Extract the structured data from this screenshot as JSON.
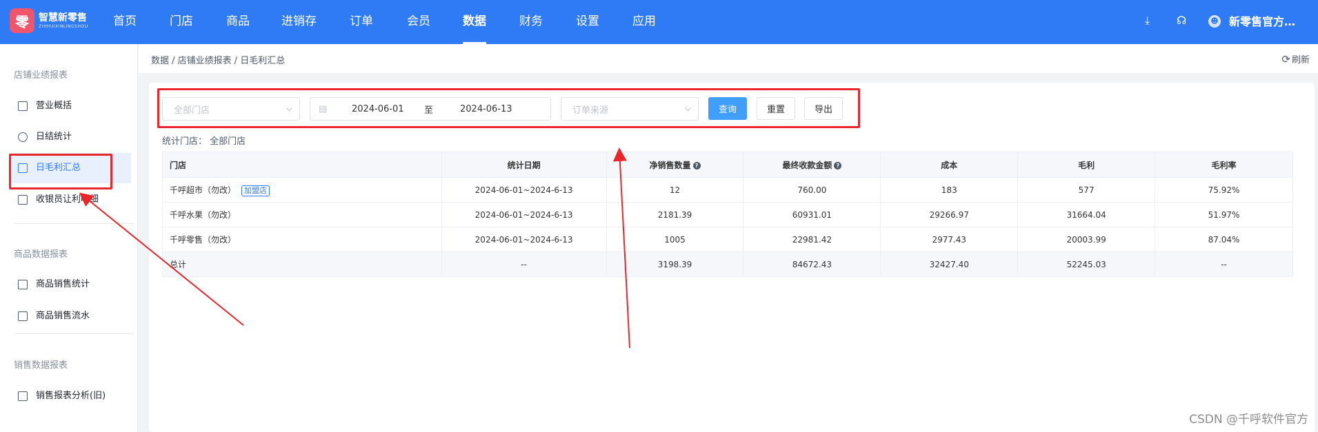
{
  "brand": {
    "logo_glyph": "零",
    "name_cn": "智慧新零售",
    "name_en": "ZHIHUIXINLINGSHOU"
  },
  "nav": {
    "items": [
      "首页",
      "门店",
      "商品",
      "进销存",
      "订单",
      "会员",
      "数据",
      "财务",
      "设置",
      "应用"
    ],
    "active": "数据"
  },
  "header": {
    "download_icon": "⤓",
    "headset_icon": "☊",
    "user_avatar": "☻",
    "user_name": "新零售官方…"
  },
  "sidebar": {
    "group1": "店铺业绩报表",
    "items1": [
      "营业概括",
      "日结统计",
      "日毛利汇总",
      "收银员让利明细"
    ],
    "group2": "商品数据报表",
    "items2": [
      "商品销售统计",
      "商品销售流水"
    ],
    "group3": "销售数据报表",
    "items3": [
      "销售报表分析(旧)"
    ]
  },
  "breadcrumb": "数据 / 店铺业绩报表 / 日毛利汇总",
  "refresh_label": "刷新",
  "filters": {
    "store_placeholder": "全部门店",
    "date_start": "2024-06-01",
    "date_sep": "至",
    "date_end": "2024-06-13",
    "order_source_placeholder": "订单来源",
    "query_label": "查询",
    "reset_label": "重置",
    "export_label": "导出"
  },
  "stat_store": "统计门店： 全部门店",
  "table": {
    "columns": [
      "门店",
      "统计日期",
      "净销售数量",
      "最终收款金额",
      "成本",
      "毛利",
      "毛利率"
    ],
    "rows": [
      {
        "store": "千呼超市（勿改）",
        "tag": "加盟店",
        "date": "2024-06-01~2024-6-13",
        "qty": "12",
        "amount": "760.00",
        "cost": "183",
        "profit": "577",
        "rate": "75.92%"
      },
      {
        "store": "千呼水果（勿改）",
        "tag": "",
        "date": "2024-06-01~2024-6-13",
        "qty": "2181.39",
        "amount": "60931.01",
        "cost": "29266.97",
        "profit": "31664.04",
        "rate": "51.97%"
      },
      {
        "store": "千呼零售（勿改）",
        "tag": "",
        "date": "2024-06-01~2024-6-13",
        "qty": "1005",
        "amount": "22981.42",
        "cost": "2977.43",
        "profit": "20003.99",
        "rate": "87.04%"
      }
    ],
    "total": {
      "store": "总计",
      "date": "--",
      "qty": "3198.39",
      "amount": "84672.43",
      "cost": "32427.40",
      "profit": "52245.03",
      "rate": "--"
    }
  },
  "watermark": "CSDN @千呼软件官方",
  "colors": {
    "primary": "#2f7bf6",
    "annotation": "#e8262b"
  }
}
